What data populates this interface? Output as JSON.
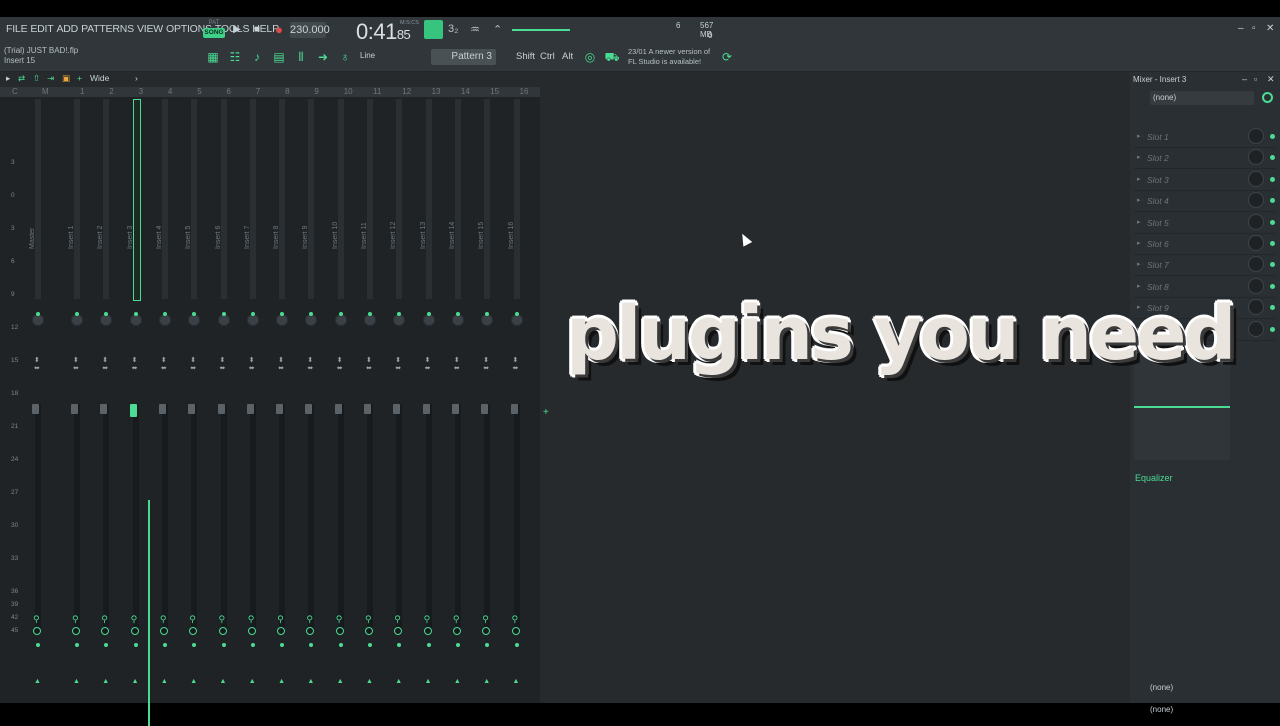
{
  "menu": [
    "FILE",
    "EDIT",
    "ADD",
    "PATTERNS",
    "VIEW",
    "OPTIONS",
    "TOOLS",
    "HELP"
  ],
  "transport": {
    "pat_label": "PAT",
    "song_label": "SONG",
    "tempo": "230.000",
    "time_main": "0:41",
    "time_sub": "85",
    "time_unit": "M:S:CS"
  },
  "cpu": {
    "cpu_val": "6",
    "mem": "567 MB",
    "poly": "0"
  },
  "file": {
    "name": "(Trial) JUST BAD!.flp",
    "track": "Insert 15"
  },
  "toolbar2": {
    "line": "Line",
    "pattern": "Pattern 3",
    "shift": "Shift",
    "ctrl": "Ctrl",
    "alt": "Alt"
  },
  "news": {
    "line1": "23/01  A newer version of",
    "line2": "FL Studio is available!"
  },
  "mixer_toolbar": {
    "view": "Wide"
  },
  "track_numbers": [
    "C",
    "M",
    "1",
    "2",
    "3",
    "4",
    "5",
    "6",
    "7",
    "8",
    "9",
    "10",
    "11",
    "12",
    "13",
    "14",
    "15",
    "16"
  ],
  "scale": [
    "3",
    "0",
    "3",
    "6",
    "9",
    "12",
    "15",
    "18",
    "21",
    "24",
    "27",
    "30",
    "33",
    "36",
    "39",
    "42",
    "45"
  ],
  "strips": [
    "Master",
    "Insert 1",
    "Insert 2",
    "Insert 3",
    "Insert 4",
    "Insert 5",
    "Insert 6",
    "Insert 7",
    "Insert 8",
    "Insert 9",
    "Insert 10",
    "Insert 11",
    "Insert 12",
    "Insert 13",
    "Insert 14",
    "Insert 15",
    "Insert 16"
  ],
  "selected_strip": "Insert 3",
  "right_panel": {
    "title": "Mixer - Insert 3",
    "input": "(none)",
    "slots": [
      "Slot 1",
      "Slot 2",
      "Slot 3",
      "Slot 4",
      "Slot 5",
      "Slot 6",
      "Slot 7",
      "Slot 8",
      "Slot 9",
      "Slot 10"
    ],
    "equalizer": "Equalizer",
    "out1": "(none)",
    "out2": "(none)"
  },
  "overlay_text": "plugins you need",
  "colors": {
    "accent": "#4bdb93",
    "background": "#262a2d",
    "panel": "#30363a"
  }
}
